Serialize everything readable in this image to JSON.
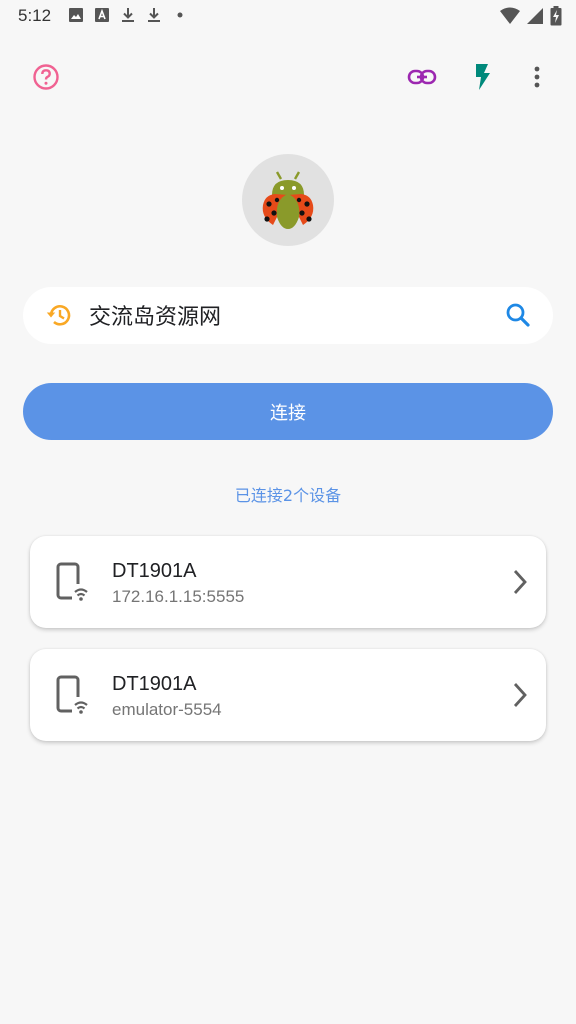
{
  "status_bar": {
    "time": "5:12",
    "left_icons": [
      "image-icon",
      "a-letter-icon",
      "download-icon",
      "download-icon",
      "dot-icon"
    ],
    "right_icons": [
      "wifi-icon",
      "signal-icon",
      "battery-charging-icon"
    ]
  },
  "toolbar": {
    "help_icon": "help-circle-icon",
    "link_icon": "link-icon",
    "flash_icon": "flash-icon",
    "more_icon": "more-vert-icon",
    "colors": {
      "help": "#f06292",
      "link": "#9c27b0",
      "flash": "#00897b"
    }
  },
  "logo": {
    "icon": "ladybug-android-icon"
  },
  "search": {
    "history_icon": "history-icon",
    "value": "交流岛资源网",
    "search_icon": "search-icon",
    "history_color": "#f9a825",
    "search_color": "#1e88e5"
  },
  "connect_button": {
    "label": "连接",
    "color": "#5b93e6"
  },
  "connected_text": "已连接2个设备",
  "devices": [
    {
      "name": "DT1901A",
      "address": "172.16.1.15:5555",
      "icon": "phone-wifi-icon"
    },
    {
      "name": "DT1901A",
      "address": "emulator-5554",
      "icon": "phone-wifi-icon"
    }
  ]
}
